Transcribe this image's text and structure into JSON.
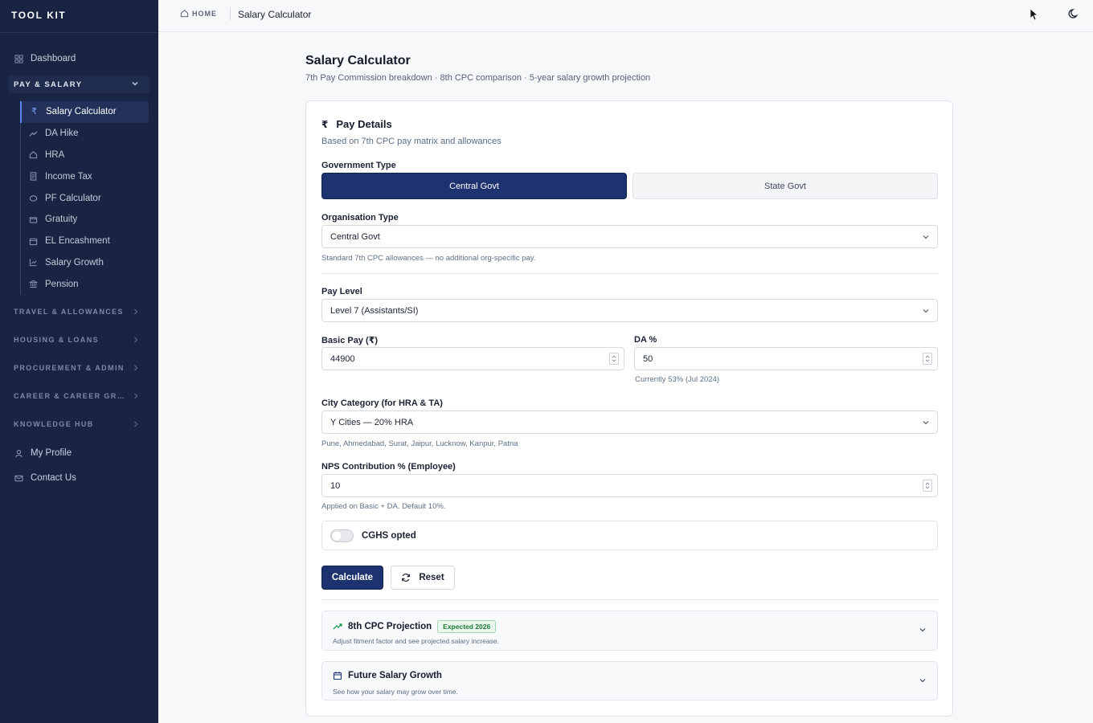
{
  "brand": "TOOL KIT",
  "sidebar": {
    "dashboard": "Dashboard",
    "open_section": "PAY & SALARY",
    "pay_items": [
      {
        "label": "Salary Calculator",
        "icon": "rupee-icon"
      },
      {
        "label": "DA Hike",
        "icon": "trending-up-icon"
      },
      {
        "label": "HRA",
        "icon": "home-icon"
      },
      {
        "label": "Income Tax",
        "icon": "receipt-icon"
      },
      {
        "label": "PF Calculator",
        "icon": "piggy-bank-icon"
      },
      {
        "label": "Gratuity",
        "icon": "wallet-icon"
      },
      {
        "label": "EL Encashment",
        "icon": "calendar-icon"
      },
      {
        "label": "Salary Growth",
        "icon": "chart-icon"
      },
      {
        "label": "Pension",
        "icon": "landmark-icon"
      }
    ],
    "closed_sections": [
      "TRAVEL & ALLOWANCES",
      "HOUSING & LOANS",
      "PROCUREMENT & ADMIN",
      "CAREER & CAREER GROW...",
      "KNOWLEDGE HUB"
    ],
    "my_profile": "My Profile",
    "contact_us": "Contact Us"
  },
  "topbar": {
    "home": "HOME",
    "current": "Salary Calculator"
  },
  "page": {
    "title": "Salary Calculator",
    "subtitle": "7th Pay Commission breakdown · 8th CPC comparison · 5-year salary growth projection"
  },
  "card": {
    "title": "Pay Details",
    "subtitle": "Based on 7th CPC pay matrix and allowances",
    "gov_type_label": "Government Type",
    "gov_options": [
      "Central Govt",
      "State Govt"
    ],
    "org_type_label": "Organisation Type",
    "org_type_value": "Central Govt",
    "org_type_help": "Standard 7th CPC allowances — no additional org-specific pay.",
    "pay_level_label": "Pay Level",
    "pay_level_value": "Level 7 (Assistants/SI)",
    "basic_pay_label": "Basic Pay (₹)",
    "basic_pay_value": "44900",
    "da_label": "DA %",
    "da_value": "50",
    "da_help": "Currently 53% (Jul 2024)",
    "city_label": "City Category (for HRA & TA)",
    "city_value": "Y Cities — 20% HRA",
    "city_help": "Pune, Ahmedabad, Surat, Jaipur, Lucknow, Kanpur, Patna",
    "nps_label": "NPS Contribution % (Employee)",
    "nps_value": "10",
    "nps_help": "Applied on Basic + DA. Default 10%.",
    "cghs_label": "CGHS opted",
    "calculate": "Calculate",
    "reset": "Reset"
  },
  "accordions": [
    {
      "title": "8th CPC Projection",
      "badge": "Expected 2026",
      "subtitle": "Adjust fitment factor and see projected salary increase."
    },
    {
      "title": "Future Salary Growth",
      "subtitle": "See how your salary may grow over time."
    }
  ],
  "colors": {
    "sidebar_bg": "#182441",
    "primary": "#1c3370",
    "accent": "#5a86ff",
    "badge_green": "#1f7a3a",
    "trend_green": "#1f9d55"
  }
}
